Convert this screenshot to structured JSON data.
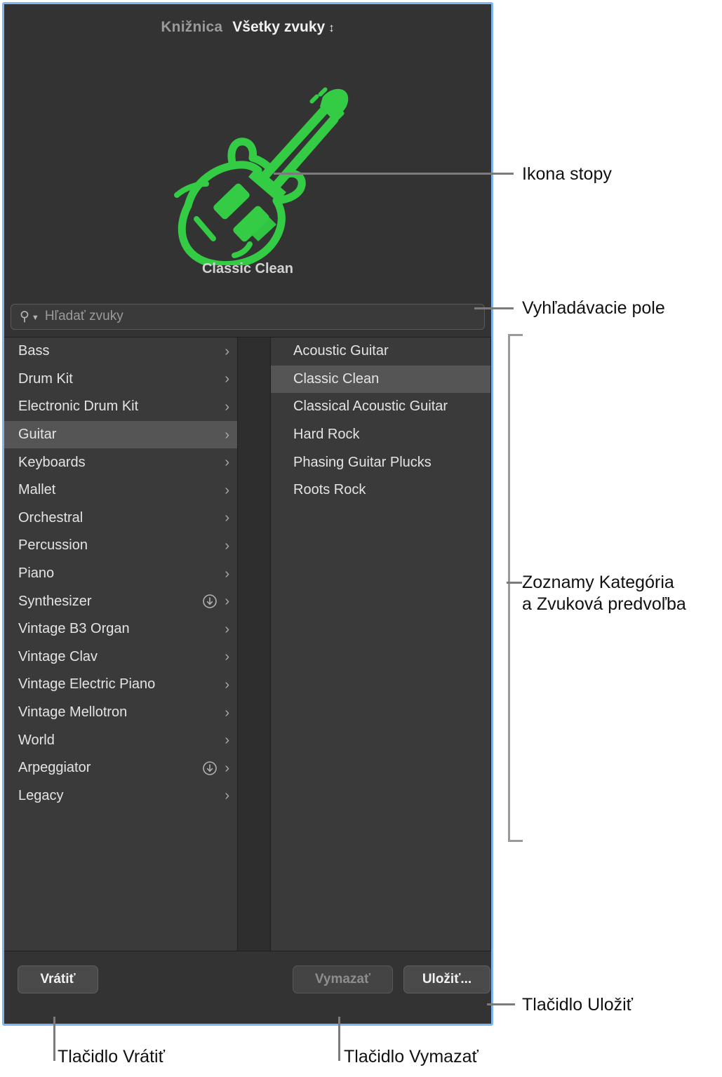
{
  "panel": {
    "header": {
      "library_label": "Knižnica",
      "filter_label": "Všetky zvuky",
      "stepper_icon": "up-down-stepper-icon"
    },
    "preview": {
      "icon_name": "electric-guitar-icon",
      "icon_color": "#33cc44",
      "patch_name": "Classic Clean"
    },
    "search": {
      "icon_name": "search-icon",
      "placeholder": "Hľadať zvuky",
      "value": ""
    },
    "categories": [
      {
        "label": "Bass",
        "selected": false,
        "download": false
      },
      {
        "label": "Drum Kit",
        "selected": false,
        "download": false
      },
      {
        "label": "Electronic Drum Kit",
        "selected": false,
        "download": false
      },
      {
        "label": "Guitar",
        "selected": true,
        "download": false
      },
      {
        "label": "Keyboards",
        "selected": false,
        "download": false
      },
      {
        "label": "Mallet",
        "selected": false,
        "download": false
      },
      {
        "label": "Orchestral",
        "selected": false,
        "download": false
      },
      {
        "label": "Percussion",
        "selected": false,
        "download": false
      },
      {
        "label": "Piano",
        "selected": false,
        "download": false
      },
      {
        "label": "Synthesizer",
        "selected": false,
        "download": true
      },
      {
        "label": "Vintage B3 Organ",
        "selected": false,
        "download": false
      },
      {
        "label": "Vintage Clav",
        "selected": false,
        "download": false
      },
      {
        "label": "Vintage Electric Piano",
        "selected": false,
        "download": false
      },
      {
        "label": "Vintage Mellotron",
        "selected": false,
        "download": false
      },
      {
        "label": "World",
        "selected": false,
        "download": false
      },
      {
        "label": "Arpeggiator",
        "selected": false,
        "download": true
      },
      {
        "label": "Legacy",
        "selected": false,
        "download": false
      }
    ],
    "patches": [
      {
        "label": "Acoustic Guitar",
        "selected": false
      },
      {
        "label": "Classic Clean",
        "selected": true
      },
      {
        "label": "Classical Acoustic Guitar",
        "selected": false
      },
      {
        "label": "Hard Rock",
        "selected": false
      },
      {
        "label": "Phasing Guitar Plucks",
        "selected": false
      },
      {
        "label": "Roots Rock",
        "selected": false
      }
    ],
    "footer": {
      "revert_label": "Vrátiť",
      "delete_label": "Vymazať",
      "save_label": "Uložiť..."
    }
  },
  "callouts": {
    "track_icon": "Ikona stopy",
    "search_field": "Vyhľadávacie pole",
    "lists_line1": "Zoznamy Kategória",
    "lists_line2": "a Zvuková predvoľba",
    "save_button": "Tlačidlo Uložiť",
    "revert_button": "Tlačidlo Vrátiť",
    "delete_button": "Tlačidlo Vymazať"
  },
  "colors": {
    "panel_background": "#333333",
    "list_background": "#3a3a3a",
    "selection": "#555555",
    "focus_border": "#7eb6f0",
    "accent_green": "#33cc44"
  }
}
